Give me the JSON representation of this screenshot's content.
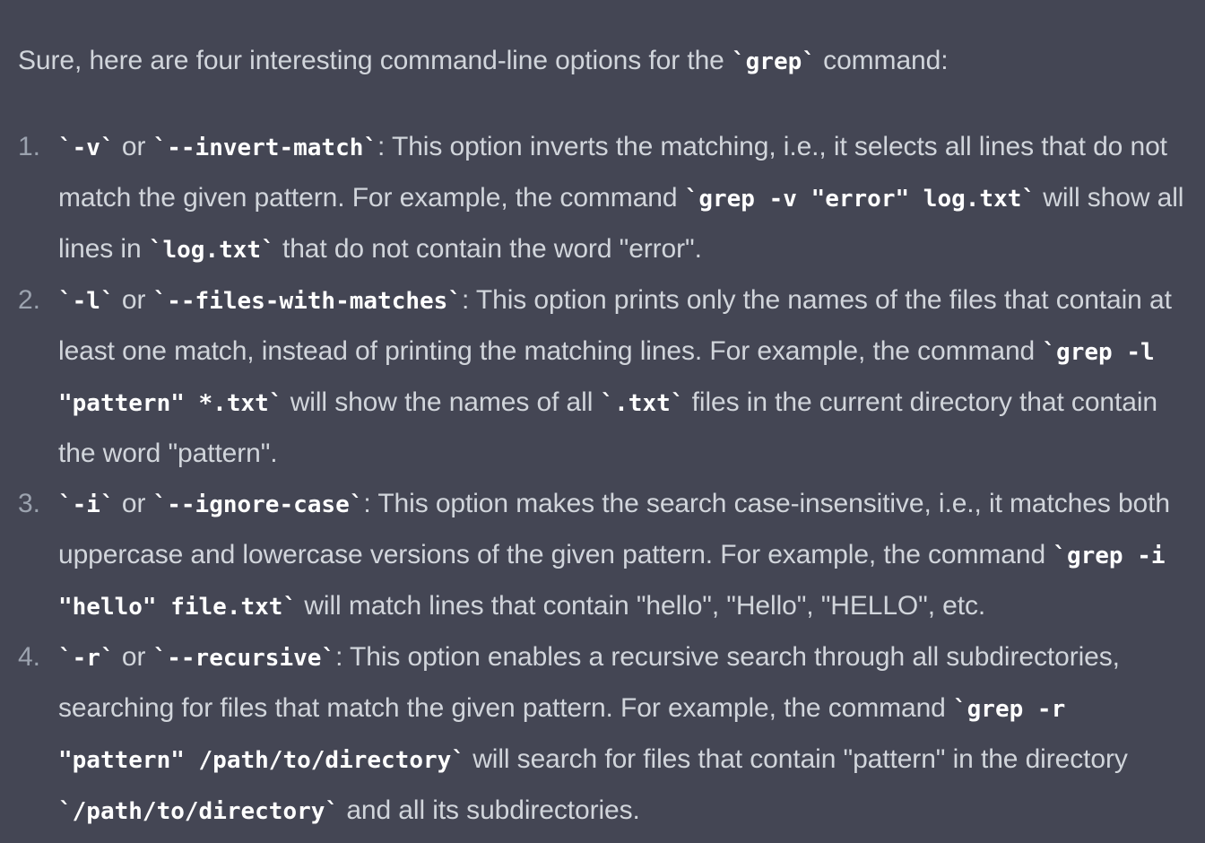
{
  "intro": {
    "before": "Sure, here are four interesting command-line options for the ",
    "code": "grep",
    "after": " command:"
  },
  "items": [
    {
      "number": "1.",
      "opt_short": "-v",
      "or": " or ",
      "opt_long": "--invert-match",
      "desc_1": ": This option inverts the matching, i.e., it selects all lines that do not match the given pattern. For example, the command ",
      "code_1": "grep -v \"error\" log.txt",
      "desc_2": " will show all lines in ",
      "code_2": "log.txt",
      "desc_3": " that do not contain the word \"error\"."
    },
    {
      "number": "2.",
      "opt_short": "-l",
      "or": " or ",
      "opt_long": "--files-with-matches",
      "desc_1": ": This option prints only the names of the files that contain at least one match, instead of printing the matching lines. For example, the command ",
      "code_1": "grep -l \"pattern\" *.txt",
      "desc_2": " will show the names of all ",
      "code_2": ".txt",
      "desc_3": " files in the current directory that contain the word \"pattern\"."
    },
    {
      "number": "3.",
      "opt_short": "-i",
      "or": " or ",
      "opt_long": "--ignore-case",
      "desc_1": ": This option makes the search case-insensitive, i.e., it matches both uppercase and lowercase versions of the given pattern. For example, the command ",
      "code_1": "grep -i \"hello\" file.txt",
      "desc_2": " will match lines that contain \"hello\", \"Hello\", \"HELLO\", etc.",
      "code_2": null,
      "desc_3": null
    },
    {
      "number": "4.",
      "opt_short": "-r",
      "or": " or ",
      "opt_long": "--recursive",
      "desc_1": ": This option enables a recursive search through all subdirectories, searching for files that match the given pattern. For example, the command ",
      "code_1": "grep -r \"pattern\" /path/to/directory",
      "desc_2": " will search for files that contain \"pattern\" in the directory ",
      "code_2": "/path/to/directory",
      "desc_3": " and all its subdirectories."
    }
  ],
  "colors": {
    "background": "#444654",
    "text": "#d1d5db",
    "code": "#ffffff",
    "list_number": "#9ca3af"
  }
}
